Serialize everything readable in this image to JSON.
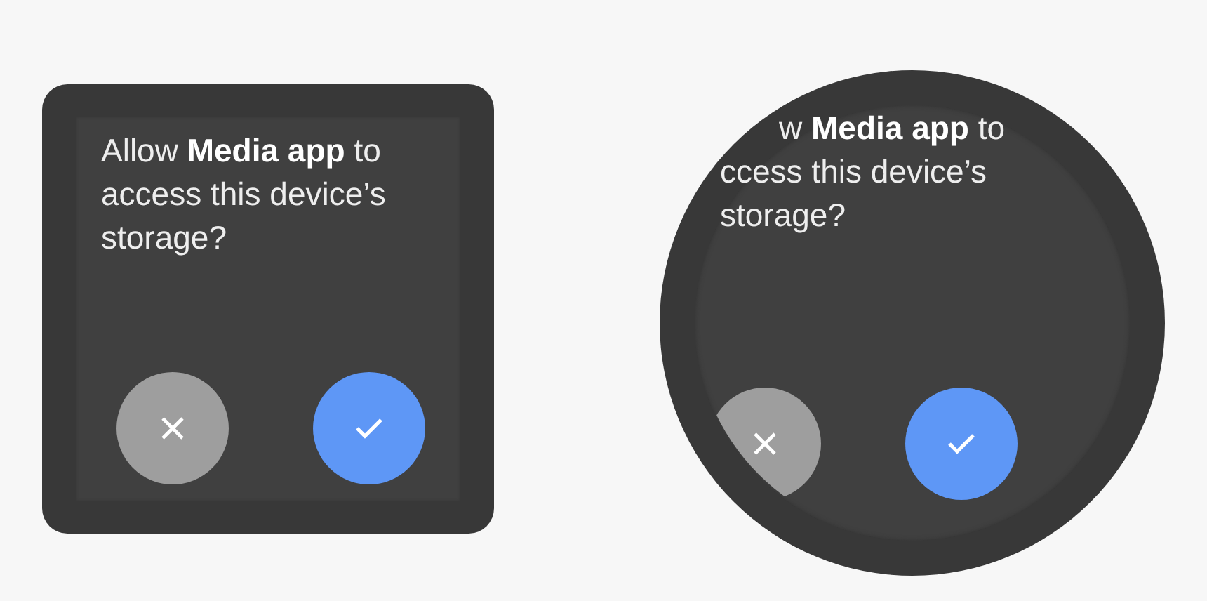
{
  "watches": [
    {
      "kind": "square",
      "prompt_lines": [
        "Allow **Media app** to",
        "access this device’s",
        "storage?"
      ],
      "buttons": [
        {
          "kind": "decline"
        },
        {
          "kind": "accept"
        }
      ]
    },
    {
      "kind": "round",
      "prompt_lines": [
        "w **Media app** to",
        "ccess this device’s",
        "storage?"
      ],
      "buttons": [
        {
          "kind": "decline"
        },
        {
          "kind": "accept"
        }
      ]
    }
  ]
}
